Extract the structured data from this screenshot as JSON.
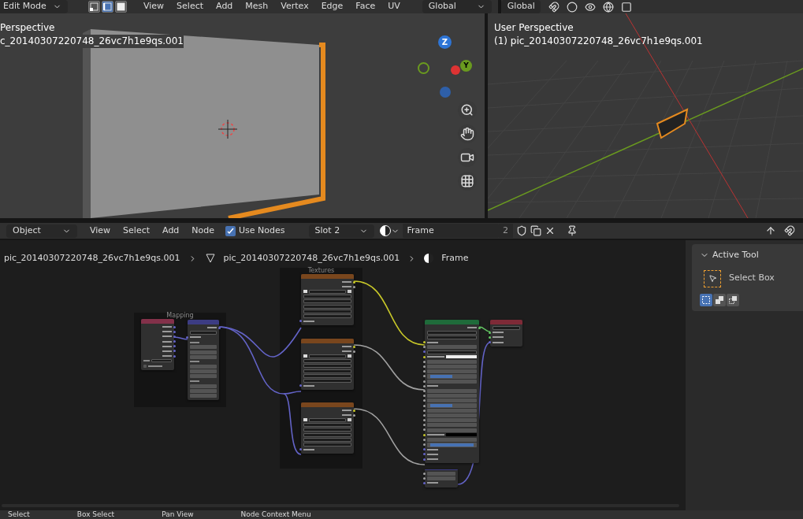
{
  "top_header": {
    "mode": "Edit Mode",
    "select_modes": [
      {
        "kind": "vertex",
        "selected": false
      },
      {
        "kind": "edge",
        "selected": true
      },
      {
        "kind": "face",
        "selected": false
      }
    ],
    "menus": [
      "View",
      "Select",
      "Add",
      "Mesh",
      "Vertex",
      "Edge",
      "Face",
      "UV"
    ],
    "orientation": "Global",
    "right_orientation": "Global"
  },
  "viewport_left": {
    "title": "Perspective",
    "object": "c_20140307220748_26vc7h1e9qs.001",
    "gizmo": {
      "z": "Z",
      "y": "Y"
    }
  },
  "viewport_right": {
    "title": "User Perspective",
    "object": "(1) pic_20140307220748_26vc7h1e9qs.001"
  },
  "node_header": {
    "object_type": "Object",
    "menus": [
      "View",
      "Select",
      "Add",
      "Node"
    ],
    "use_nodes": {
      "label": "Use Nodes",
      "checked": true
    },
    "slot": "Slot 2",
    "material": "Frame",
    "users": "2"
  },
  "breadcrumb": [
    "pic_20140307220748_26vc7h1e9qs.001",
    "pic_20140307220748_26vc7h1e9qs.001",
    "Frame"
  ],
  "frames": [
    "Mapping",
    "Textures"
  ],
  "nodes": [
    {
      "color": "#83314a",
      "rows": [
        {
          "kind": "out",
          "color": "#6363c7"
        },
        {
          "kind": "out",
          "color": "#6363c7"
        },
        {
          "kind": "out",
          "color": "#6363c7"
        },
        {
          "kind": "out",
          "color": "#6363c7"
        },
        {
          "kind": "out",
          "color": "#6363c7"
        },
        {
          "kind": "out",
          "color": "#6363c7"
        },
        {
          "kind": "out",
          "color": "#6363c7"
        },
        {
          "kind": "object"
        },
        {
          "kind": "check",
          "checked": false
        }
      ]
    },
    {
      "color": "#3c3c83",
      "rows": [
        {
          "kind": "out",
          "color": "#6363c7"
        },
        {
          "kind": "select"
        },
        {
          "kind": "in",
          "color": "#6363c7"
        },
        {
          "kind": "label"
        },
        {
          "kind": "slider"
        },
        {
          "kind": "slider"
        },
        {
          "kind": "slider"
        },
        {
          "kind": "label"
        },
        {
          "kind": "slider"
        },
        {
          "kind": "slider"
        },
        {
          "kind": "slider"
        },
        {
          "kind": "label"
        },
        {
          "kind": "slider"
        },
        {
          "kind": "slider"
        },
        {
          "kind": "slider"
        }
      ]
    },
    {
      "color": "#79461d",
      "rows": [
        {
          "kind": "out",
          "color": "#c7c729"
        },
        {
          "kind": "out",
          "color": "#a1a1a1"
        },
        {
          "kind": "image"
        },
        {
          "kind": "select"
        },
        {
          "kind": "select"
        },
        {
          "kind": "select"
        },
        {
          "kind": "select"
        },
        {
          "kind": "select"
        },
        {
          "kind": "in",
          "color": "#6363c7"
        }
      ]
    },
    {
      "color": "#79461d",
      "rows": [
        {
          "kind": "out",
          "color": "#c7c729"
        },
        {
          "kind": "out",
          "color": "#a1a1a1"
        },
        {
          "kind": "image"
        },
        {
          "kind": "select"
        },
        {
          "kind": "select"
        },
        {
          "kind": "select"
        },
        {
          "kind": "select"
        },
        {
          "kind": "select"
        },
        {
          "kind": "in",
          "color": "#6363c7"
        }
      ]
    },
    {
      "color": "#79461d",
      "rows": [
        {
          "kind": "out",
          "color": "#c7c729"
        },
        {
          "kind": "out",
          "color": "#a1a1a1"
        },
        {
          "kind": "image"
        },
        {
          "kind": "select"
        },
        {
          "kind": "select"
        },
        {
          "kind": "select"
        },
        {
          "kind": "select"
        },
        {
          "kind": "select"
        },
        {
          "kind": "in",
          "color": "#6363c7"
        }
      ]
    },
    {
      "color": "#1f6b3a",
      "rows": [
        {
          "kind": "out",
          "color": "#63c763"
        },
        {
          "kind": "select"
        },
        {
          "kind": "select"
        },
        {
          "kind": "in",
          "color": "#c7c729"
        },
        {
          "kind": "slider",
          "color": "#a1a1a1"
        },
        {
          "kind": "select",
          "color": "#6363c7"
        },
        {
          "kind": "swatch",
          "color": "#eeeeee"
        },
        {
          "kind": "slider",
          "color": "#a1a1a1"
        },
        {
          "kind": "slider",
          "color": "#a1a1a1"
        },
        {
          "kind": "slider",
          "color": "#a1a1a1"
        },
        {
          "kind": "slider",
          "color": "#a1a1a1",
          "level": 0.5
        },
        {
          "kind": "slider",
          "color": "#a1a1a1"
        },
        {
          "kind": "in",
          "color": "#a1a1a1"
        },
        {
          "kind": "slider",
          "color": "#a1a1a1"
        },
        {
          "kind": "slider",
          "color": "#a1a1a1"
        },
        {
          "kind": "slider",
          "color": "#a1a1a1"
        },
        {
          "kind": "slider",
          "color": "#a1a1a1",
          "level": 0.5
        },
        {
          "kind": "slider",
          "color": "#a1a1a1"
        },
        {
          "kind": "slider",
          "color": "#a1a1a1"
        },
        {
          "kind": "slider",
          "color": "#a1a1a1"
        },
        {
          "kind": "slider",
          "color": "#a1a1a1"
        },
        {
          "kind": "slider",
          "color": "#a1a1a1"
        },
        {
          "kind": "swatch",
          "color": "#000000"
        },
        {
          "kind": "slider",
          "color": "#a1a1a1"
        },
        {
          "kind": "slider",
          "color": "#a1a1a1",
          "level": 1
        },
        {
          "kind": "in",
          "color": "#6363c7"
        },
        {
          "kind": "in",
          "color": "#6363c7"
        },
        {
          "kind": "in",
          "color": "#6363c7"
        }
      ]
    },
    {
      "color": "#3c3c83",
      "rows": [
        {
          "kind": "slider",
          "color": "#a1a1a1"
        },
        {
          "kind": "slider",
          "color": "#a1a1a1"
        },
        {
          "kind": "in",
          "color": "#6363c7"
        }
      ]
    },
    {
      "color": "#7e2a37",
      "rows": [
        {
          "kind": "select"
        },
        {
          "kind": "in",
          "color": "#63c763"
        },
        {
          "kind": "in",
          "color": "#63c763"
        },
        {
          "kind": "in",
          "color": "#6363c7"
        }
      ]
    }
  ],
  "sidebar": {
    "panel": "Active Tool",
    "tool": "Select Box",
    "box_modes": [
      {
        "kind": "new",
        "selected": true
      },
      {
        "kind": "extend",
        "selected": false
      },
      {
        "kind": "subtract",
        "selected": false
      }
    ]
  },
  "status_bar": [
    "Select",
    "Box Select",
    "Pan View",
    "Node Context Menu"
  ]
}
